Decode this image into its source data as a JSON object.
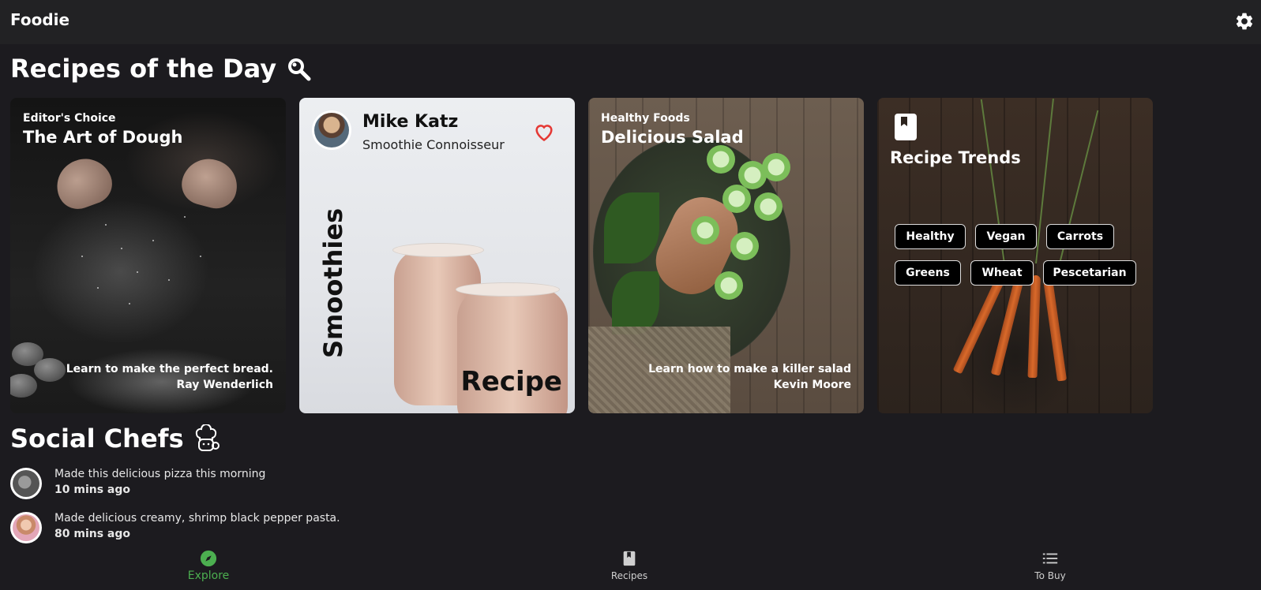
{
  "app": {
    "title": "Foodie"
  },
  "sections": {
    "recipes_of_day": "Recipes of the Day",
    "social_chefs": "Social Chefs"
  },
  "cards": {
    "art_of_dough": {
      "label": "Editor's Choice",
      "title": "The Art of Dough",
      "description": "Learn to make the perfect bread.",
      "author": "Ray Wenderlich"
    },
    "smoothies": {
      "author_name": "Mike Katz",
      "author_title": "Smoothie Connoisseur",
      "vertical_title": "Smoothies",
      "bottom_label": "Recipe"
    },
    "salad": {
      "label": "Healthy Foods",
      "title": "Delicious Salad",
      "description": "Learn how to make a killer salad",
      "author": "Kevin Moore"
    },
    "trends": {
      "title": "Recipe Trends",
      "tags": [
        "Healthy",
        "Vegan",
        "Carrots",
        "Greens",
        "Wheat",
        "Pescetarian"
      ]
    }
  },
  "posts": [
    {
      "message": "Made this delicious pizza this morning",
      "time": "10 mins ago"
    },
    {
      "message": "Made delicious creamy, shrimp black pepper pasta.",
      "time": "80 mins ago"
    }
  ],
  "nav": {
    "explore": "Explore",
    "recipes": "Recipes",
    "to_buy": "To Buy"
  },
  "colors": {
    "background": "#1c1b1f",
    "app_bar": "#222224",
    "accent_green": "#4caf50",
    "heart_red": "#e53935"
  },
  "icons": {
    "settings": "gear-icon",
    "search": "magnifier-icon",
    "chef": "chef-icon",
    "favorite": "heart-outline-icon",
    "bookmark": "book-icon",
    "explore": "compass-icon",
    "list": "list-icon"
  }
}
